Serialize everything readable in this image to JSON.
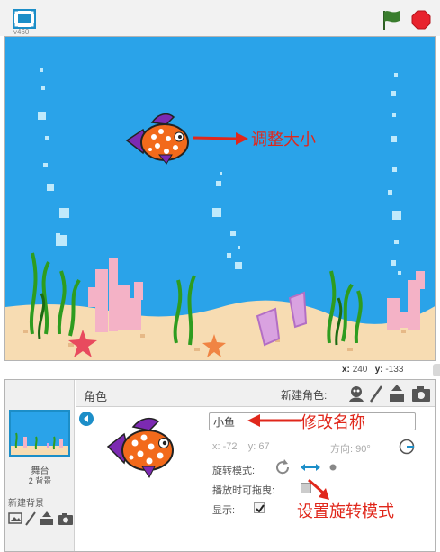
{
  "toolbar": {
    "version": "v460",
    "fullscreen_icon": "fullscreen-icon",
    "green_flag_icon": "green-flag-icon",
    "stop_icon": "stop-sign-icon",
    "flag_color": "#3a7d2e",
    "stop_color": "#e8222d"
  },
  "stage": {
    "background_color": "#2aa3e9",
    "sand_color": "#f7dcb2",
    "coords": {
      "x_label": "x:",
      "x_value": "240",
      "y_label": "y:",
      "y_value": "-133"
    }
  },
  "annotations": {
    "resize": "调整大小",
    "rename": "修改名称",
    "rotation": "设置旋转模式",
    "color": "#e0271b"
  },
  "sidebar": {
    "stage_label": "舞台",
    "backdrop_count": "2 背景",
    "new_backdrop_label": "新建背景",
    "tools": [
      "paint-brush-icon",
      "paint-brush-icon",
      "upload-icon",
      "camera-icon"
    ]
  },
  "sprites": {
    "title": "角色",
    "new_sprite_label": "新建角色:",
    "new_sprite_tools": [
      "sprite-library-icon",
      "paint-brush-icon",
      "upload-icon",
      "camera-icon"
    ]
  },
  "sprite_info": {
    "name": "小鱼",
    "x_label": "x:",
    "x_value": "-72",
    "y_label": "y:",
    "y_value": "67",
    "direction_label": "方向:",
    "direction_value": "90°",
    "rotation_label": "旋转模式:",
    "rotation_modes": [
      "rotate-all-around-icon",
      "left-right-icon",
      "dont-rotate-icon"
    ],
    "draggable_label": "播放时可拖曳:",
    "show_label": "显示:",
    "accent_color": "#1c8ec8"
  }
}
